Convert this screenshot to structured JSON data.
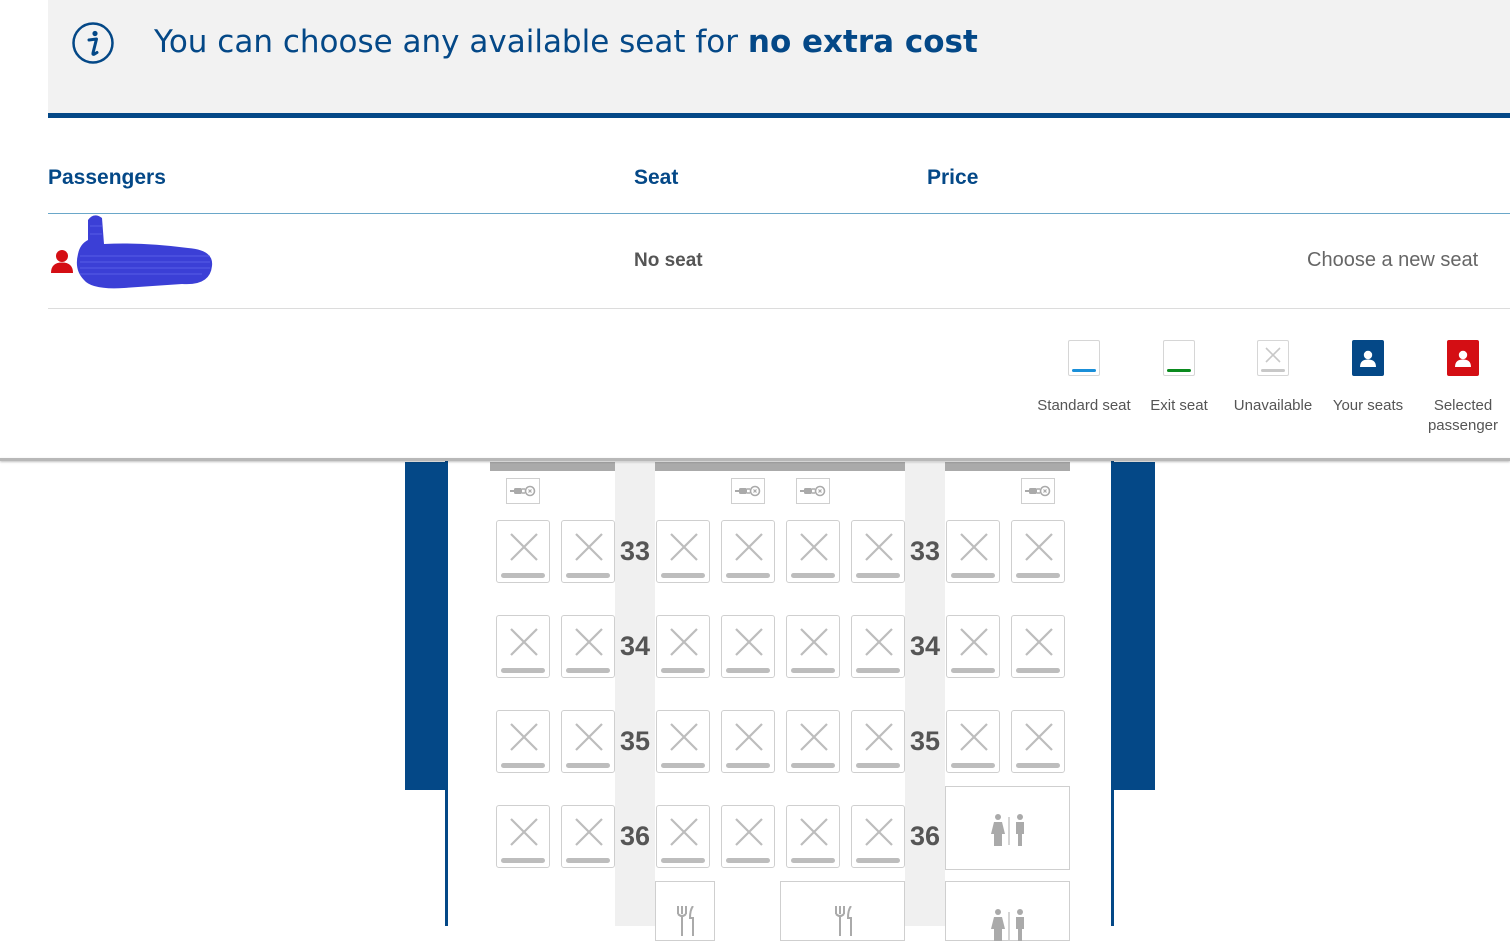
{
  "banner": {
    "message_prefix": "You can choose any available seat for",
    "message_emphasis": "no extra cost",
    "icon": "info-icon"
  },
  "table": {
    "headers": {
      "passengers": "Passengers",
      "seat": "Seat",
      "price": "Price"
    },
    "passenger": {
      "icon": "person-icon",
      "seat_value": "No seat",
      "action": "Choose a new seat"
    }
  },
  "legend": [
    {
      "label": "Standard seat",
      "color": "#1a8fd9"
    },
    {
      "label": "Exit seat",
      "color": "#0a8a1e"
    },
    {
      "label": "Unavailable",
      "color": "#c8c8c8"
    },
    {
      "label": "Your seats",
      "color": "#044887"
    },
    {
      "label": "Selected passenger",
      "color": "#d40e14"
    }
  ],
  "seatmap": {
    "rows": [
      "33",
      "34",
      "35",
      "36"
    ],
    "seat_status": "Unavailable",
    "facilities": [
      "lavatory-icon",
      "galley-icon",
      "power-outlet-icon"
    ]
  },
  "colors": {
    "brand": "#044887",
    "accent_red": "#d40e14"
  }
}
